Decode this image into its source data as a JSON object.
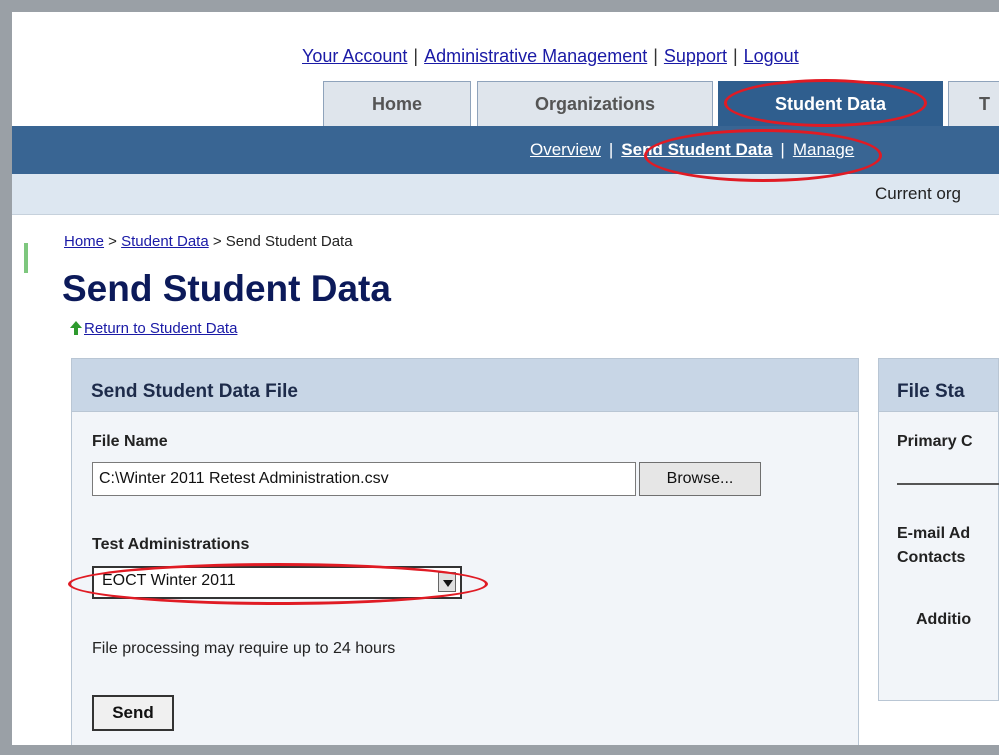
{
  "top_links": [
    "Your Account",
    "Administrative Management",
    "Support",
    "Logout"
  ],
  "tabs": [
    "Home",
    "Organizations",
    "Student Data",
    "T"
  ],
  "subnav": [
    "Overview",
    "Send Student Data",
    "Manage"
  ],
  "org_bar_text": "Current org",
  "breadcrumb": {
    "home": "Home",
    "sep1": " > ",
    "student_data": "Student Data",
    "sep2": " > ",
    "current": "Send Student Data"
  },
  "page_title": "Send Student Data",
  "return_link": "Return to Student Data",
  "form_panel": {
    "title": "Send Student Data File",
    "file_name_label": "File Name",
    "file_name_value": "C:\\Winter 2011 Retest Administration.csv",
    "browse_label": "Browse...",
    "test_admin_label": "Test Administrations",
    "test_admin_selected": "EOCT Winter 2011",
    "processing_note": "File processing may require up to 24 hours",
    "send_label": "Send"
  },
  "status_panel": {
    "title": "File Sta",
    "primary": "Primary C",
    "email_line1": "E-mail Ad",
    "email_line2": "Contacts",
    "additional": "Additio"
  },
  "colors": {
    "nav": "#396593",
    "annotation": "#e01b24",
    "panel_header": "#c8d6e6"
  },
  "icons": [
    "green-up-arrow-icon",
    "dropdown-arrow-icon"
  ]
}
